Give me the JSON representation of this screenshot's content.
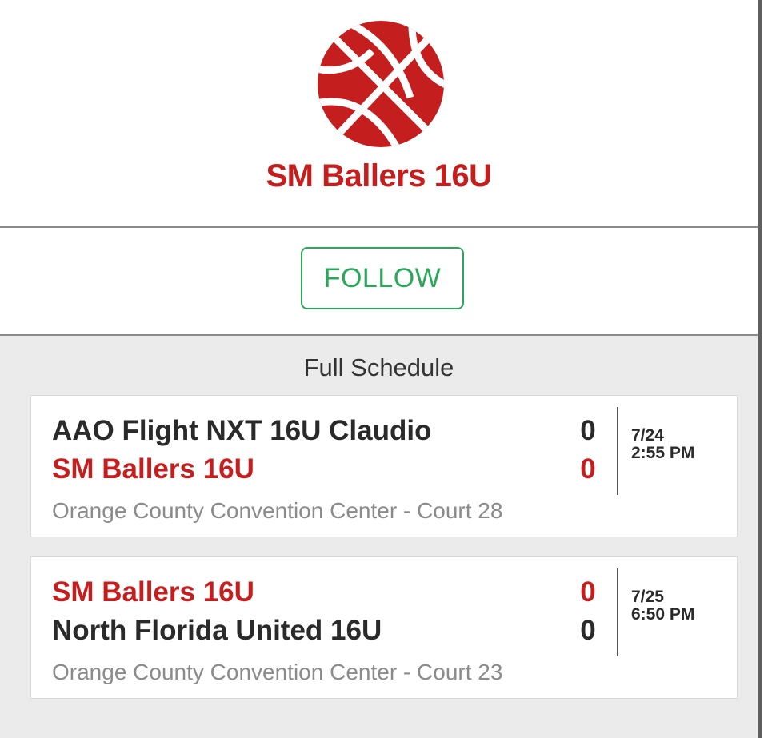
{
  "team": {
    "name": "SM Ballers 16U",
    "logo_icon": "basketball-icon",
    "brand_color": "#c41e1e"
  },
  "follow": {
    "label": "FOLLOW",
    "color": "#2aa85a"
  },
  "schedule": {
    "heading": "Full Schedule",
    "games": [
      {
        "team1": {
          "name": "AAO Flight NXT 16U Claudio",
          "score": "0"
        },
        "team2": {
          "name": "SM Ballers 16U",
          "score": "0"
        },
        "venue": "Orange County Convention Center - Court 28",
        "date": "7/24",
        "time": "2:55 PM"
      },
      {
        "team1": {
          "name": "SM Ballers 16U",
          "score": "0"
        },
        "team2": {
          "name": "North Florida United 16U",
          "score": "0"
        },
        "venue": "Orange County Convention Center - Court 23",
        "date": "7/25",
        "time": "6:50 PM"
      }
    ]
  }
}
